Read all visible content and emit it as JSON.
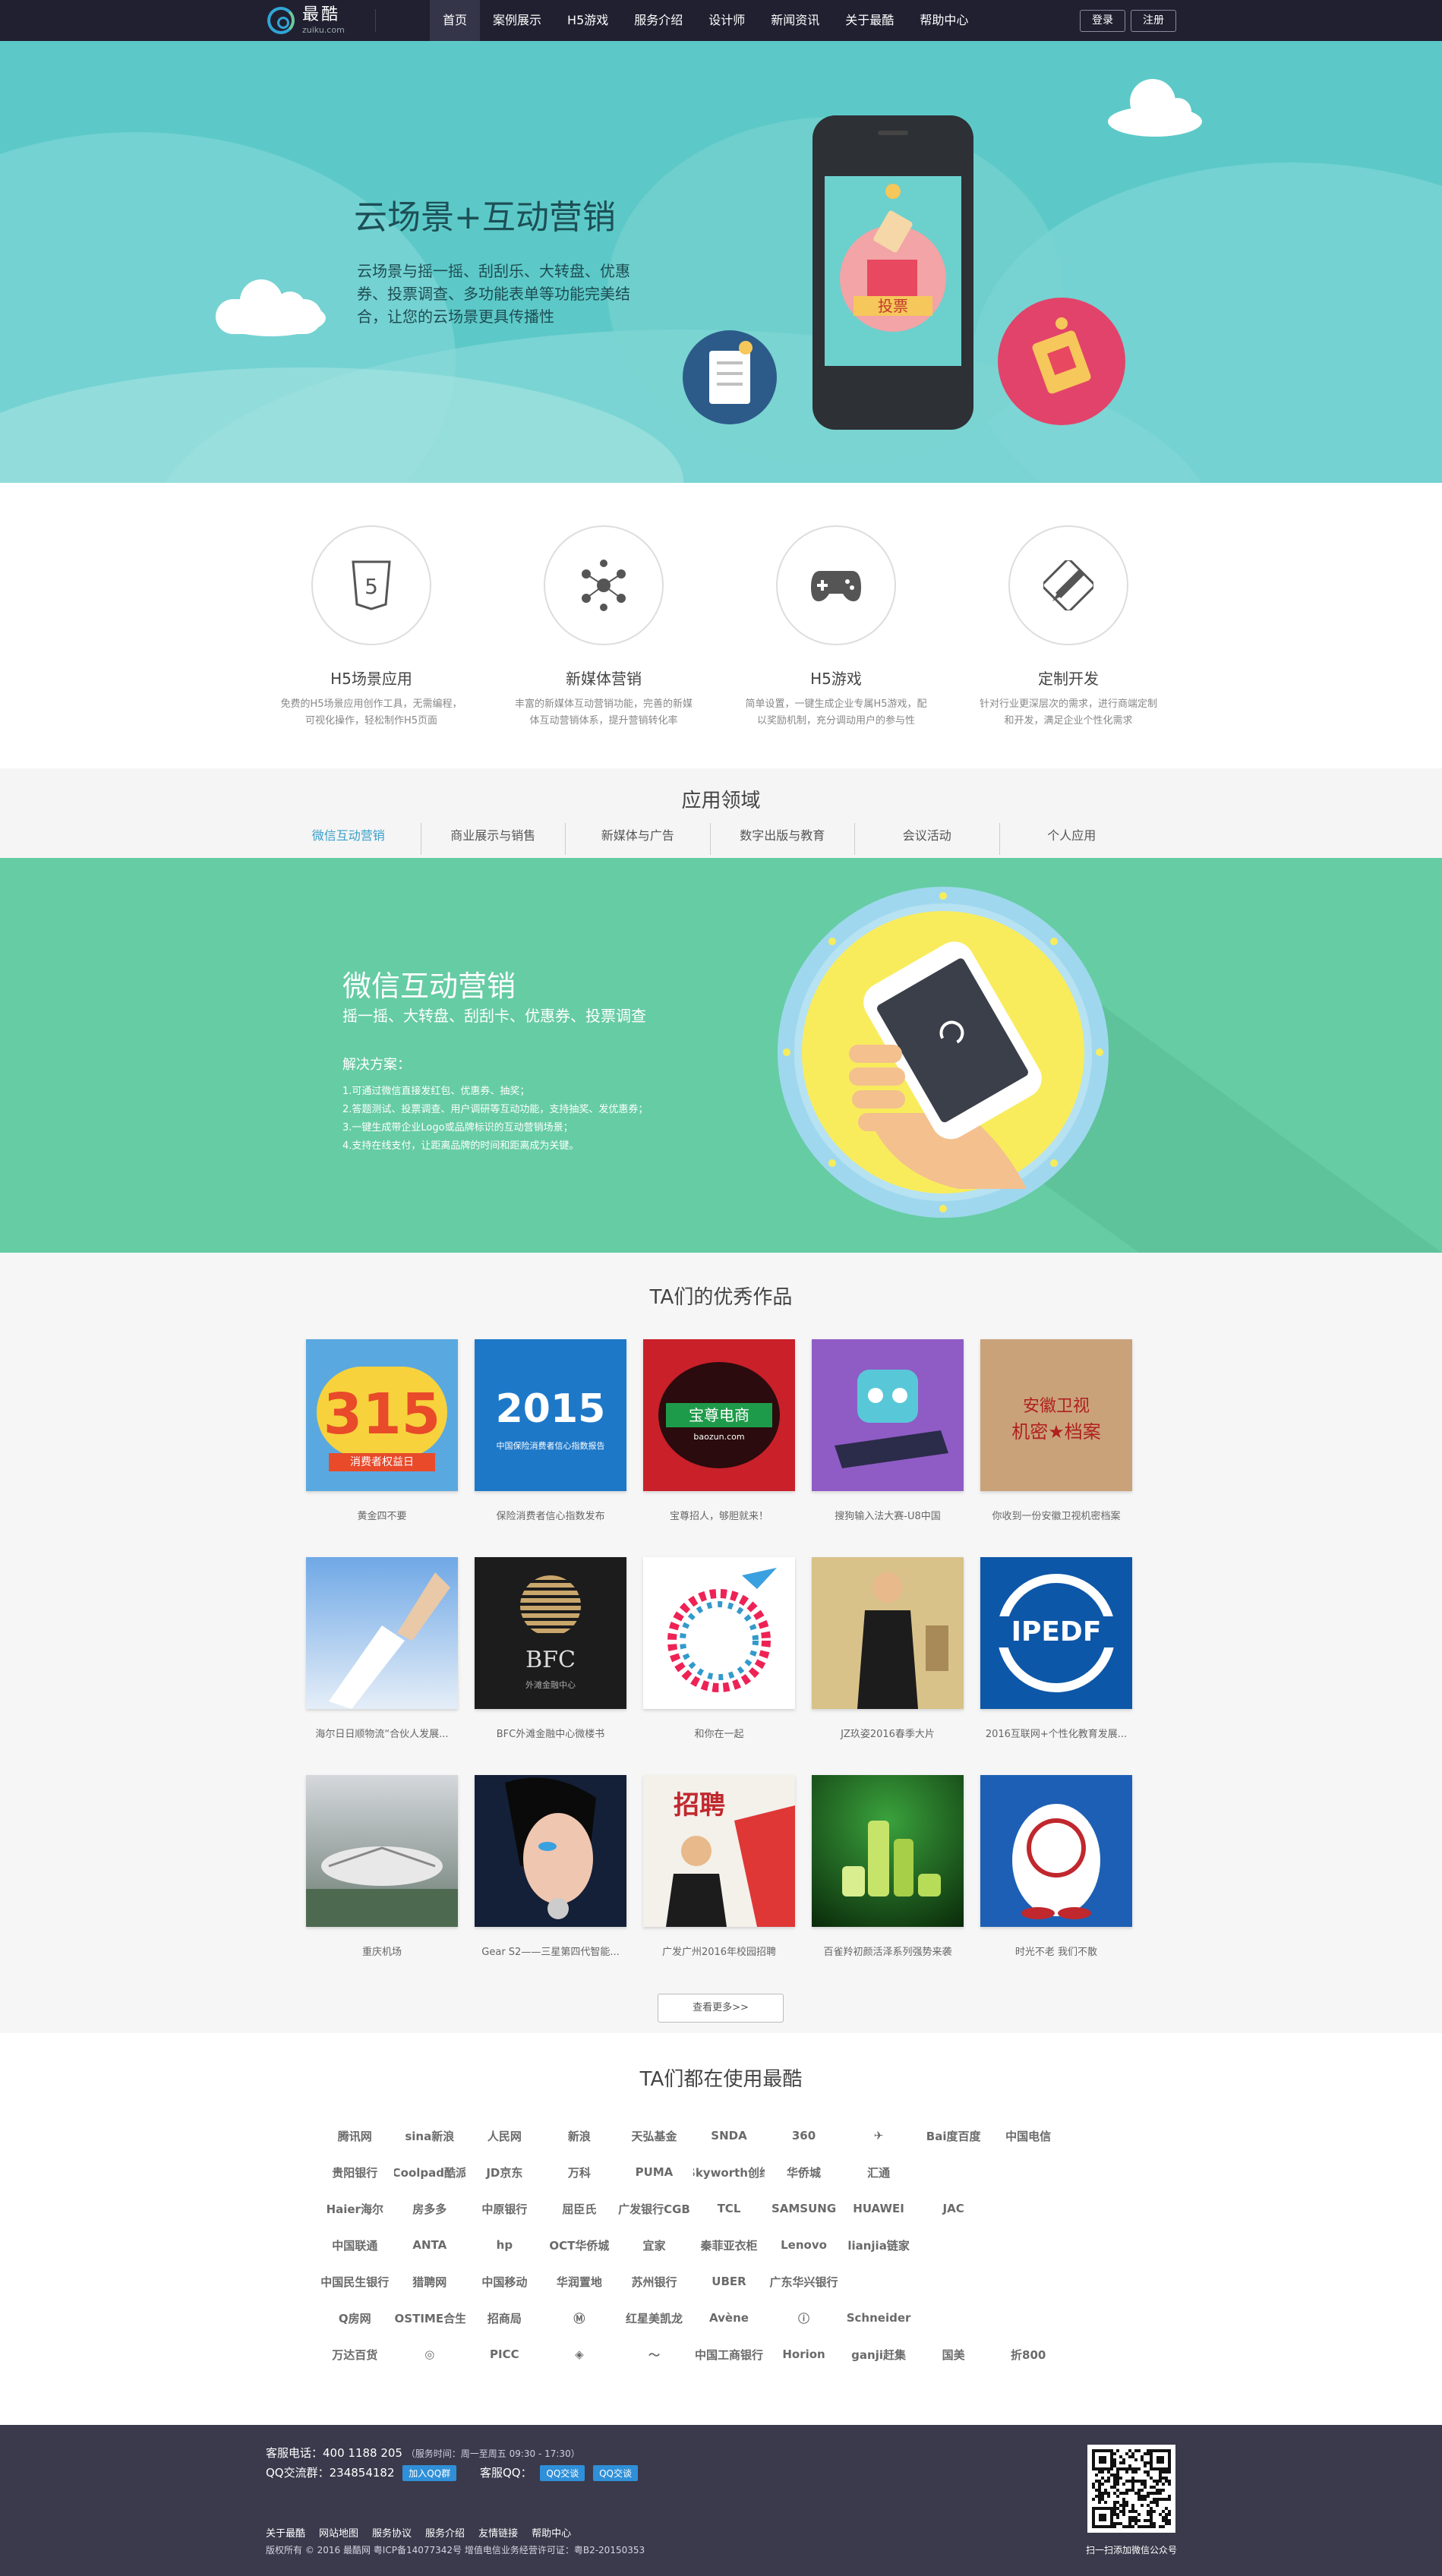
{
  "nav": {
    "logo_name": "最酷",
    "logo_domain": "zuiku.com",
    "items": [
      "首页",
      "案例展示",
      "H5游戏",
      "服务介绍",
      "设计师",
      "新闻资讯",
      "关于最酷",
      "帮助中心"
    ],
    "login": "登录",
    "register": "注册"
  },
  "hero": {
    "title": "云场景+互动营销",
    "desc": "云场景与摇一摇、刮刮乐、大转盘、优惠券、投票调查、多功能表单等功能完美结合，让您的云场景更具传播性",
    "vote_label": "投票"
  },
  "features": [
    {
      "title": "H5场景应用",
      "desc": "免费的H5场景应用创作工具，无需编程，可视化操作，轻松制作H5页面",
      "icon": "html5-icon"
    },
    {
      "title": "新媒体营销",
      "desc": "丰富的新媒体互动营销功能，完善的新媒体互动营销体系，提升营销转化率",
      "icon": "network-icon"
    },
    {
      "title": "H5游戏",
      "desc": "简单设置，一键生成企业专属H5游戏，配以奖励机制，充分调动用户的参与性",
      "icon": "gamepad-icon"
    },
    {
      "title": "定制开发",
      "desc": "针对行业更深层次的需求，进行商端定制和开发，满足企业个性化需求",
      "icon": "pencil-ruler-icon"
    }
  ],
  "application": {
    "title": "应用领域",
    "tabs": [
      "微信互动营销",
      "商业展示与销售",
      "新媒体与广告",
      "数字出版与教育",
      "会议活动",
      "个人应用"
    ]
  },
  "wechat": {
    "title": "微信互动营销",
    "subtitle": "摇一摇、大转盘、刮刮卡、优惠券、投票调查",
    "solution_label": "解决方案：",
    "solutions": [
      "1.可通过微信直接发红包、优惠券、抽奖；",
      "2.答题测试、投票调查、用户调研等互动功能，支持抽奖、发优惠券；",
      "3.一键生成带企业Logo或品牌标识的互动营销场景；",
      "4.支持在线支付，让距离品牌的时间和距离成为关键。"
    ]
  },
  "works": {
    "title": "TA们的优秀作品",
    "items": [
      {
        "caption": "黄金四不要",
        "thumb": "315"
      },
      {
        "caption": "保险消费者信心指数发布",
        "thumb": "2015"
      },
      {
        "caption": "宝尊招人，够胆就来！",
        "thumb": "baozun"
      },
      {
        "caption": "搜狗输入法大赛-U8中国",
        "thumb": "sogou"
      },
      {
        "caption": "你收到一份安徽卫视机密档案",
        "thumb": "ahtv"
      },
      {
        "caption": "海尔日日顺物流“合伙人发展...",
        "thumb": "handshake"
      },
      {
        "caption": "BFC外滩金融中心微楼书",
        "thumb": "bfc"
      },
      {
        "caption": "和你在一起",
        "thumb": "circle"
      },
      {
        "caption": "JZ玖姿2016春季大片",
        "thumb": "jz"
      },
      {
        "caption": "2016互联网+个性化教育发展...",
        "thumb": "ipedf"
      },
      {
        "caption": "重庆机场",
        "thumb": "airport"
      },
      {
        "caption": "Gear S2——三星第四代智能...",
        "thumb": "gear"
      },
      {
        "caption": "广发广州2016年校园招聘",
        "thumb": "recruit"
      },
      {
        "caption": "百雀羚初颜活泽系列强势来袭",
        "thumb": "bottles"
      },
      {
        "caption": "时光不老 我们不散",
        "thumb": "pku"
      }
    ],
    "thumb_text": {
      "t315_top": "315",
      "t315_bottom": "消费者权益日",
      "t2015": "2015",
      "t2015_sub": "中国保险消费者信心指数报告",
      "baozun": "宝尊电商",
      "baozun_url": "baozun.com",
      "ahtv_line1": "安徽卫视",
      "ahtv_line2": "机密★档案",
      "bfc": "BFC",
      "bfc_sub": "外滩金融中心",
      "ipedf": "IPEDF",
      "recruit": "招聘"
    },
    "more": "查看更多>>"
  },
  "clients": {
    "title": "TA们都在使用最酷",
    "logos": [
      "腾讯网",
      "sina新浪",
      "人民网",
      "新浪",
      "天弘基金",
      "SNDA",
      "360",
      "✈",
      "Bai度百度",
      "中国电信",
      "",
      "贵阳银行",
      "Coolpad酷派",
      "JD京东",
      "万科",
      "PUMA",
      "Skyworth创维",
      "华侨城",
      "汇通",
      "",
      "",
      "",
      "Haier海尔",
      "房多多",
      "中原银行",
      "屈臣氏",
      "广发银行CGB",
      "TCL",
      "SAMSUNG",
      "HUAWEI",
      "JAC",
      "",
      "",
      "中国联通",
      "ANTA",
      "hp",
      "OCT华侨城",
      "宜家",
      "秦菲亚衣柜",
      "Lenovo",
      "lianjia链家",
      "",
      "",
      "",
      "中国民生银行",
      "猎聘网",
      "中国移动",
      "华润置地",
      "苏州银行",
      "UBER",
      "广东华兴银行",
      "",
      "",
      "",
      "",
      "Q房网",
      "BIOSTIME合生元",
      "招商局",
      "Ⓜ",
      "红星美凯龙",
      "Avène",
      "ⓘ",
      "Schneider",
      "",
      "",
      "",
      "万达百货",
      "◎",
      "PICC",
      "◈",
      "～",
      "中国工商银行",
      "Horion",
      "ganji赶集",
      "国美",
      "折800",
      ""
    ]
  },
  "footer": {
    "phone": "客服电话：400 1188 205",
    "hours": "（服务时间：周一至周五 09:30 - 17:30）",
    "qq_group": "QQ交流群：234854182",
    "join_qq": "加入QQ群",
    "service_qq": "客服QQ：",
    "qq_chat_1": "QQ交谈",
    "qq_chat_2": "QQ交谈",
    "links": [
      "关于最酷",
      "网站地图",
      "服务协议",
      "服务介绍",
      "友情链接",
      "帮助中心"
    ],
    "copyright": "版权所有 © 2016  最酷网  粤ICP备14077342号  增值电信业务经营许可证：粤B2-20150353",
    "qr_caption": "扫一扫添加微信公众号"
  },
  "colors": {
    "nav_bg": "#202031",
    "hero_bg": "#5cc9c8",
    "wechat_bg": "#66cca4",
    "footer_bg": "#3a3a4c",
    "accent": "#3aa0c9"
  }
}
